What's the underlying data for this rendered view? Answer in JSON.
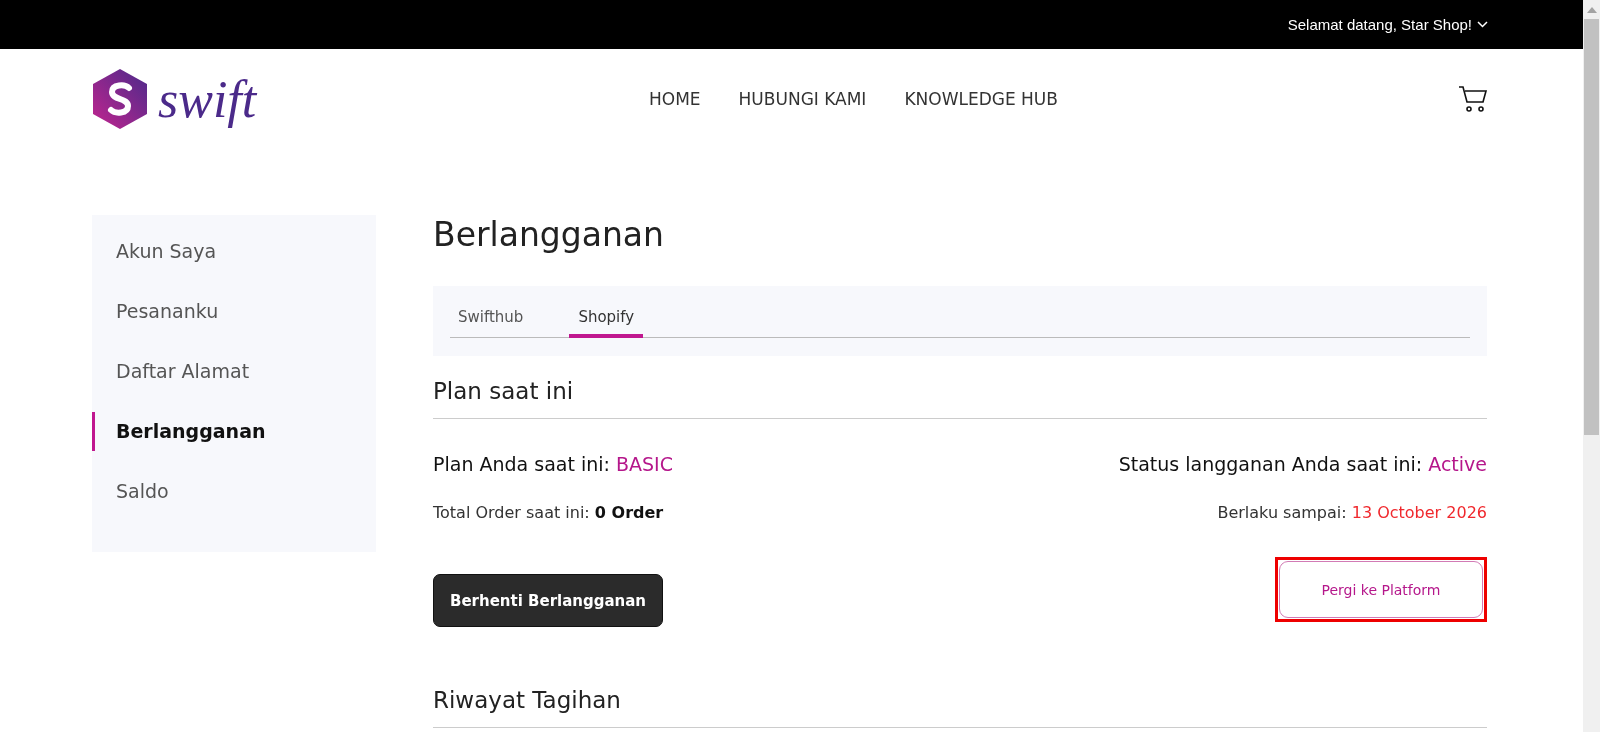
{
  "top_bar": {
    "greeting": "Selamat datang, Star Shop!"
  },
  "header": {
    "logo_text": "swift",
    "nav": [
      {
        "label": "HOME"
      },
      {
        "label": "HUBUNGI KAMI"
      },
      {
        "label": "KNOWLEDGE HUB"
      }
    ]
  },
  "sidebar": {
    "items": [
      {
        "label": "Akun Saya",
        "selected": false
      },
      {
        "label": "Pesananku",
        "selected": false
      },
      {
        "label": "Daftar Alamat",
        "selected": false
      },
      {
        "label": "Berlangganan",
        "selected": true
      },
      {
        "label": "Saldo",
        "selected": false
      }
    ]
  },
  "page_title": "Berlangganan",
  "tabs": [
    {
      "label": "Swifthub",
      "selected": false
    },
    {
      "label": "Shopify",
      "selected": true
    }
  ],
  "current_plan": {
    "heading": "Plan saat ini",
    "plan_label": "Plan Anda saat ini:",
    "plan_value": "BASIC",
    "status_label": "Status langganan Anda saat ini:",
    "status_value": "Active",
    "orders_label": "Total Order saat ini:",
    "orders_value": "0 Order",
    "valid_label": "Berlaku sampai:",
    "valid_value": "13 October 2026"
  },
  "buttons": [
    {
      "label": "Berhenti Berlangganan",
      "kind": "dark",
      "highlighted": false
    },
    {
      "label": "Pergi ke Platform",
      "kind": "outline",
      "highlighted": true
    }
  ],
  "billing_history": {
    "heading": "Riwayat Tagihan"
  }
}
